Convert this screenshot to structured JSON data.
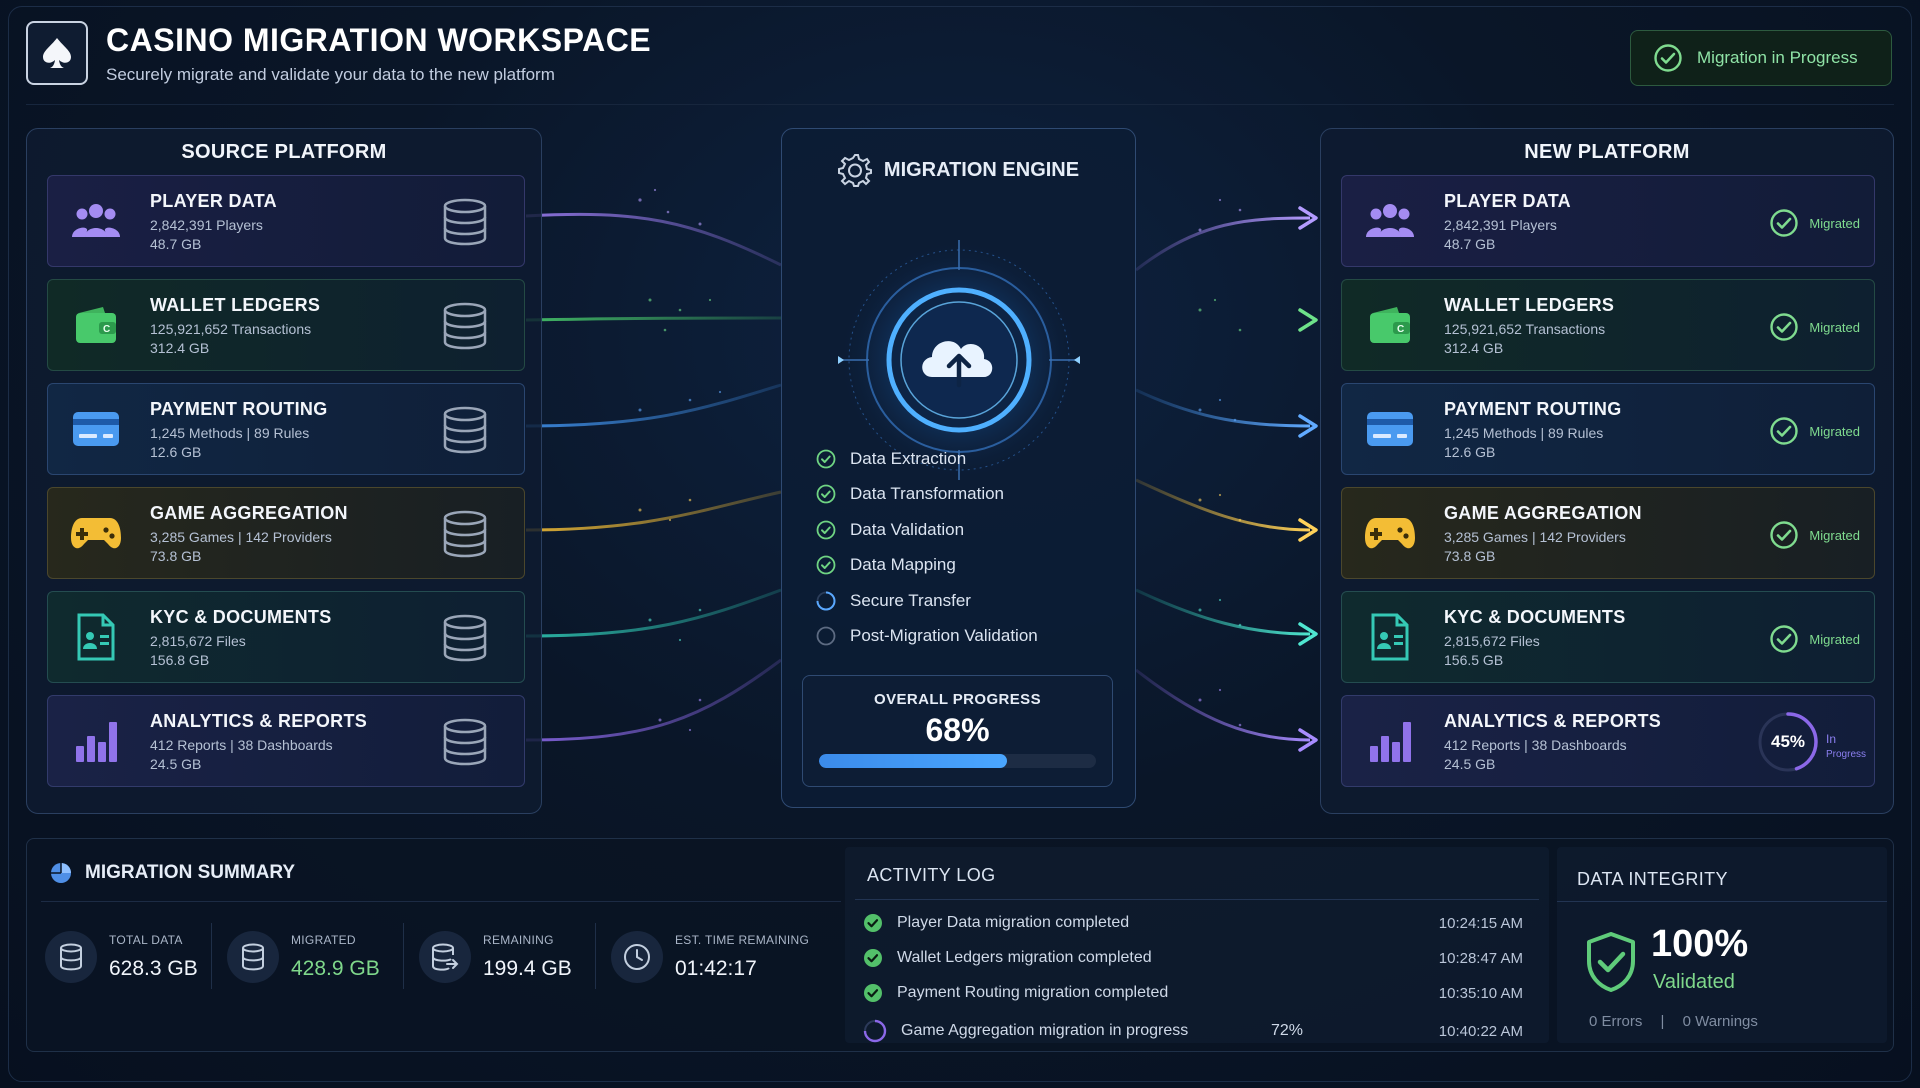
{
  "header": {
    "title": "CASINO MIGRATION WORKSPACE",
    "subtitle": "Securely migrate and validate your data to the new platform",
    "status": "Migration in Progress"
  },
  "source": {
    "title": "SOURCE PLATFORM",
    "items": [
      {
        "name": "PLAYER DATA",
        "line1": "2,842,391 Players",
        "line2": "48.7 GB"
      },
      {
        "name": "WALLET LEDGERS",
        "line1": "125,921,652 Transactions",
        "line2": "312.4 GB"
      },
      {
        "name": "PAYMENT ROUTING",
        "line1": "1,245 Methods  |  89 Rules",
        "line2": "12.6 GB"
      },
      {
        "name": "GAME AGGREGATION",
        "line1": "3,285 Games  |  142 Providers",
        "line2": "73.8 GB"
      },
      {
        "name": "KYC & DOCUMENTS",
        "line1": "2,815,672 Files",
        "line2": "156.8 GB"
      },
      {
        "name": "ANALYTICS & REPORTS",
        "line1": "412 Reports  |  38 Dashboards",
        "line2": "24.5 GB"
      }
    ]
  },
  "target": {
    "title": "NEW PLATFORM",
    "items": [
      {
        "name": "PLAYER DATA",
        "line1": "2,842,391 Players",
        "line2": "48.7 GB",
        "status": "Migrated"
      },
      {
        "name": "WALLET LEDGERS",
        "line1": "125,921,652 Transactions",
        "line2": "312.4 GB",
        "status": "Migrated"
      },
      {
        "name": "PAYMENT ROUTING",
        "line1": "1,245 Methods  |  89 Rules",
        "line2": "12.6 GB",
        "status": "Migrated"
      },
      {
        "name": "GAME AGGREGATION",
        "line1": "3,285 Games  |  142 Providers",
        "line2": "73.8 GB",
        "status": "Migrated"
      },
      {
        "name": "KYC & DOCUMENTS",
        "line1": "2,815,672 Files",
        "line2": "156.5 GB",
        "status": "Migrated"
      },
      {
        "name": "ANALYTICS & REPORTS",
        "line1": "412 Reports  |  38 Dashboards",
        "line2": "24.5 GB",
        "progress": "45%",
        "progress_fraction": 0.45,
        "status1": "In",
        "status2": "Progress"
      }
    ]
  },
  "engine": {
    "title": "MIGRATION ENGINE",
    "steps": [
      {
        "label": "Data Extraction",
        "done": true
      },
      {
        "label": "Data Transformation",
        "done": true
      },
      {
        "label": "Data Validation",
        "done": true
      },
      {
        "label": "Data Mapping",
        "done": true
      },
      {
        "label": "Secure Transfer",
        "done": false,
        "active": true
      },
      {
        "label": "Post-Migration Validation",
        "done": false
      }
    ],
    "overall_label": "OVERALL PROGRESS",
    "overall_value": "68%",
    "overall_fraction": 0.68
  },
  "summary": {
    "title": "MIGRATION SUMMARY",
    "stats": [
      {
        "label": "TOTAL DATA",
        "value": "628.3 GB"
      },
      {
        "label": "MIGRATED",
        "value": "428.9 GB"
      },
      {
        "label": "REMAINING",
        "value": "199.4 GB"
      },
      {
        "label": "EST. TIME REMAINING",
        "value": "01:42:17"
      }
    ]
  },
  "activity": {
    "title": "ACTIVITY LOG",
    "rows": [
      {
        "text": "Player Data migration completed",
        "time": "10:24:15 AM",
        "pct": ""
      },
      {
        "text": "Wallet Ledgers migration completed",
        "time": "10:28:47 AM",
        "pct": ""
      },
      {
        "text": "Payment Routing migration completed",
        "time": "10:35:10 AM",
        "pct": ""
      },
      {
        "text": "Game Aggregation migration in progress",
        "time": "10:40:22 AM",
        "pct": "72%"
      }
    ]
  },
  "integrity": {
    "title": "DATA INTEGRITY",
    "value": "100%",
    "status": "Validated",
    "errors": "0 Errors",
    "warnings": "0 Warnings"
  },
  "colors": {
    "player": "#9b7cf0",
    "wallet": "#48c96b",
    "payment": "#3f8fe8",
    "game": "#f3bd35",
    "kyc": "#2fc7b3",
    "analytics": "#8b68e8",
    "success": "#7fdb8f"
  }
}
